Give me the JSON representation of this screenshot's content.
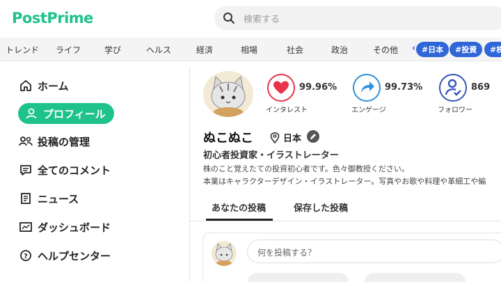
{
  "header": {
    "logo_part1": "Post",
    "logo_part2": "Prime",
    "search_placeholder": "検索する"
  },
  "categories": [
    "トレンド",
    "ライフ",
    "学び",
    "ヘルス",
    "経済",
    "相場",
    "社会",
    "政治",
    "その他"
  ],
  "tags": [
    "#日本",
    "#投資",
    "#株元"
  ],
  "sidebar": {
    "items": [
      {
        "label": "ホーム",
        "icon": "home-icon"
      },
      {
        "label": "プロフィール",
        "icon": "user-icon"
      },
      {
        "label": "投稿の管理",
        "icon": "users-icon"
      },
      {
        "label": "全てのコメント",
        "icon": "comment-icon"
      },
      {
        "label": "ニュース",
        "icon": "news-icon"
      },
      {
        "label": "ダッシュボード",
        "icon": "dashboard-icon"
      },
      {
        "label": "ヘルプセンター",
        "icon": "help-icon"
      }
    ]
  },
  "profile": {
    "stats": [
      {
        "value": "99.96%",
        "label": "インタレスト",
        "icon": "heart-icon",
        "color": "#e8334a"
      },
      {
        "value": "99.73%",
        "label": "エンゲージ",
        "icon": "share-arrow-icon",
        "color": "#2f8fd8"
      },
      {
        "value": "869",
        "label": "フォロワー",
        "icon": "user-check-icon",
        "color": "#3455b8"
      }
    ],
    "name": "ぬこぬこ",
    "location": "日本",
    "title": "初心者投資家・イラストレーター",
    "bio_line1": "株のこと覚えたての投資初心者です。色々御教授ください。",
    "bio_line2": "本業はキャラクターデザイン・イラストレーター。写真やお歌や料理や革細工や編"
  },
  "tabs": {
    "your_posts": "あなたの投稿",
    "saved_posts": "保存した投稿"
  },
  "composer": {
    "placeholder": "何を投稿する？"
  },
  "colors": {
    "brand": "#1fc28a",
    "tag": "#2f66d8"
  }
}
